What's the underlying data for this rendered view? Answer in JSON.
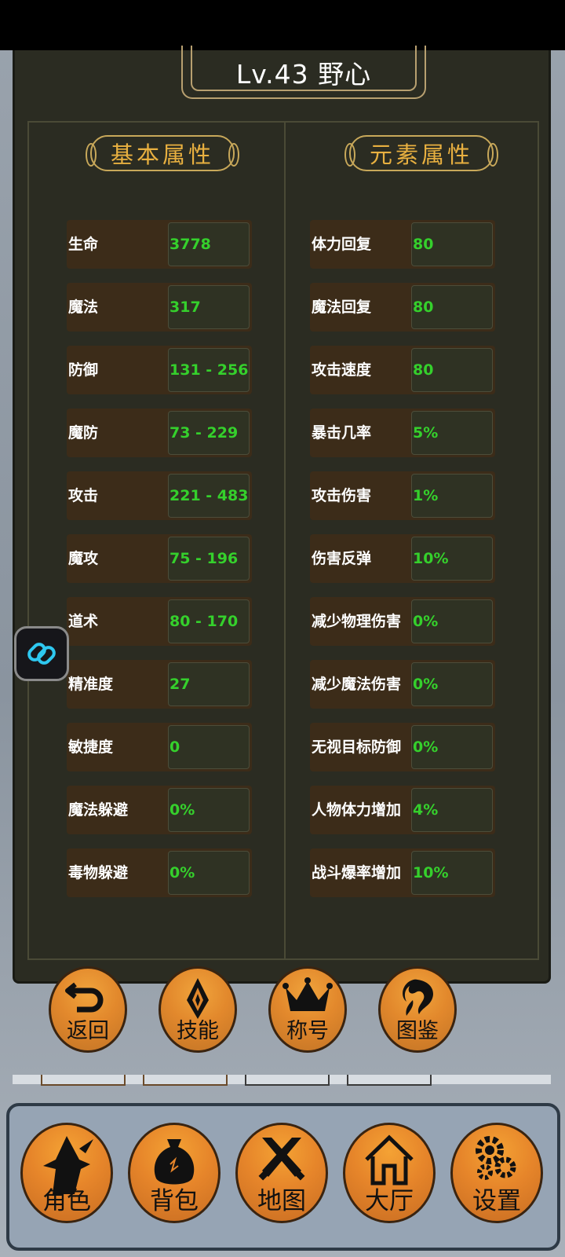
{
  "header": {
    "title": "Lv.43 野心"
  },
  "sections": {
    "basic_title": "基本属性",
    "element_title": "元素属性"
  },
  "basic_stats": [
    {
      "label": "生命",
      "value": "3778"
    },
    {
      "label": "魔法",
      "value": "317"
    },
    {
      "label": "防御",
      "value": "131 - 256"
    },
    {
      "label": "魔防",
      "value": "73 - 229"
    },
    {
      "label": "攻击",
      "value": "221 - 483"
    },
    {
      "label": "魔攻",
      "value": "75 - 196"
    },
    {
      "label": "道术",
      "value": "80 - 170"
    },
    {
      "label": "精准度",
      "value": "27"
    },
    {
      "label": "敏捷度",
      "value": "0"
    },
    {
      "label": "魔法躲避",
      "value": "0%"
    },
    {
      "label": "毒物躲避",
      "value": "0%"
    }
  ],
  "element_stats": [
    {
      "label": "体力回复",
      "value": "80"
    },
    {
      "label": "魔法回复",
      "value": "80"
    },
    {
      "label": "攻击速度",
      "value": "80"
    },
    {
      "label": "暴击几率",
      "value": "5%"
    },
    {
      "label": "攻击伤害",
      "value": "1%"
    },
    {
      "label": "伤害反弹",
      "value": "10%"
    },
    {
      "label": "减少物理伤害",
      "value": "0%"
    },
    {
      "label": "减少魔法伤害",
      "value": "0%"
    },
    {
      "label": "无视目标防御",
      "value": "0%"
    },
    {
      "label": "人物体力增加",
      "value": "4%"
    },
    {
      "label": "战斗爆率增加",
      "value": "10%"
    }
  ],
  "action_buttons": {
    "back": "返回",
    "skills": "技能",
    "titles": "称号",
    "codex": "图鉴"
  },
  "nav": {
    "character": "角色",
    "bag": "背包",
    "map": "地图",
    "hall": "大厅",
    "settings": "设置"
  },
  "colors": {
    "value_green": "#35d02c",
    "heading_gold": "#e8b040",
    "button_orange": "#e6852a"
  },
  "icons": {
    "floating": "link-chain-icon",
    "back": "undo-arrow-icon",
    "skills": "spearhead-icon",
    "titles": "crown-icon",
    "codex": "dragon-icon",
    "character": "wizard-icon",
    "bag": "sack-icon",
    "map": "crossed-swords-icon",
    "hall": "house-icon",
    "settings": "gears-icon"
  }
}
